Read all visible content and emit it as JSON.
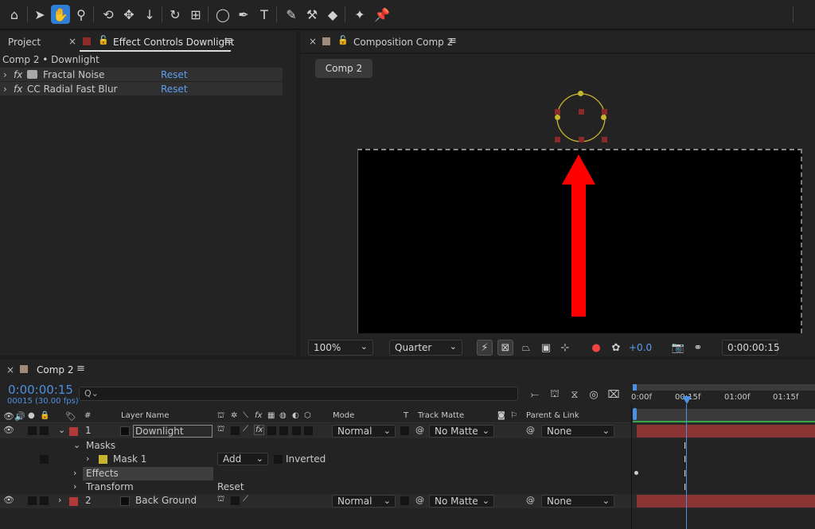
{
  "toolbar": {
    "tools": [
      "home-icon",
      "selection-arrow-icon",
      "hand-icon",
      "zoom-icon",
      "orbit-camera-icon",
      "pan-camera-icon",
      "dolly-camera-icon",
      "rotation-icon",
      "anchor-point-icon",
      "ellipse-tool-icon",
      "pen-tool-icon",
      "type-tool-icon",
      "brush-icon",
      "clone-stamp-icon",
      "eraser-icon",
      "roto-brush-icon",
      "puppet-pin-icon"
    ],
    "type_glyph": "T"
  },
  "left_panel": {
    "project_tab": "Project",
    "effect_tab": "Effect Controls Downlight",
    "breadcrumb": "Comp 2 • Downlight",
    "effects": [
      {
        "fx": "fx",
        "name": "Fractal Noise",
        "reset": "Reset"
      },
      {
        "fx": "fx",
        "name": "CC Radial Fast Blur",
        "reset": "Reset"
      }
    ]
  },
  "comp_panel": {
    "tab": "Composition Comp 2",
    "comp_button": "Comp 2",
    "zoom": "100%",
    "resolution": "Quarter",
    "exposure": "+0.0",
    "timecode": "0:00:00:15"
  },
  "timeline": {
    "tab": "Comp 2",
    "timecode": "0:00:00:15",
    "frame_info": "00015 (30.00 fps)",
    "search_glyph": "Q⌄",
    "ruler": [
      "0:00f",
      "00:15f",
      "01:00f",
      "01:15f"
    ],
    "headers": {
      "num": "#",
      "layer_name": "Layer Name",
      "mode": "Mode",
      "t": "T",
      "track_matte": "Track Matte",
      "parent": "Parent & Link",
      "fx": "fx"
    },
    "layer1": {
      "num": "1",
      "name": "Downlight",
      "mode": "Normal",
      "matte": "No Matte",
      "parent": "None",
      "fx": "fx"
    },
    "masks_label": "Masks",
    "mask1": {
      "name": "Mask 1",
      "mode": "Add",
      "inverted": "Inverted"
    },
    "effects_label": "Effects",
    "transform_label": "Transform",
    "transform_reset": "Reset",
    "layer2": {
      "num": "2",
      "name": "Back Ground",
      "mode": "Normal",
      "matte": "No Matte",
      "parent": "None"
    }
  },
  "colors": {
    "accent": "#2f7fd6",
    "link": "#5b9eef",
    "layer_red": "#b03a3a",
    "mask_yellow": "#c8b52e",
    "arrow": "#ff0000"
  }
}
